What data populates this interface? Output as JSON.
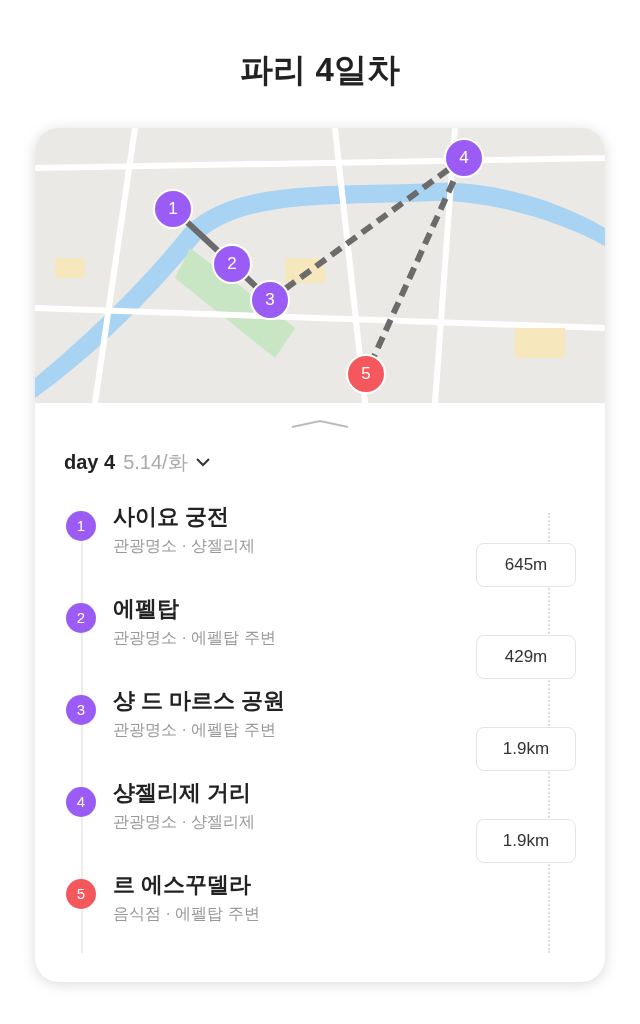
{
  "title": "파리 4일차",
  "map": {
    "kind": "picture",
    "markers": [
      {
        "label": "1",
        "color": "#9b5cf6"
      },
      {
        "label": "2",
        "color": "#9b5cf6"
      },
      {
        "label": "3",
        "color": "#9b5cf6"
      },
      {
        "label": "4",
        "color": "#9b5cf6"
      },
      {
        "label": "5",
        "color": "#f5585c"
      }
    ]
  },
  "day": {
    "label": "day 4",
    "date": "5.14/화"
  },
  "places": [
    {
      "number": "1",
      "name": "사이요 궁전",
      "detail": "관광명소 · 샹젤리제",
      "color": "#9b5cf6"
    },
    {
      "number": "2",
      "name": "에펠탑",
      "detail": "관광명소 · 에펠탑 주변",
      "color": "#9b5cf6"
    },
    {
      "number": "3",
      "name": "샹 드 마르스 공원",
      "detail": "관광명소 · 에펠탑 주변",
      "color": "#9b5cf6"
    },
    {
      "number": "4",
      "name": "샹젤리제 거리",
      "detail": "관광명소 · 샹젤리제",
      "color": "#9b5cf6"
    },
    {
      "number": "5",
      "name": "르 에스꾸델라",
      "detail": "음식점 · 에펠탑 주변",
      "color": "#f5585c"
    }
  ],
  "distances": [
    "645m",
    "429m",
    "1.9km",
    "1.9km"
  ]
}
